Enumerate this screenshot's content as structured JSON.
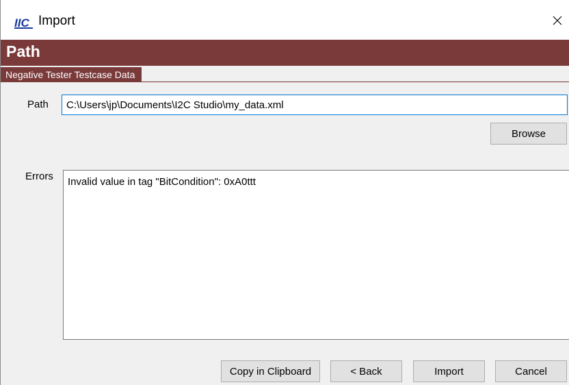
{
  "window": {
    "title": "Import",
    "app_icon": "iic-logo-icon",
    "close_icon": "close-icon"
  },
  "section": {
    "title": "Path",
    "subtitle": "Negative Tester Testcase Data"
  },
  "form": {
    "path_label": "Path",
    "path_value": "C:\\Users\\jp\\Documents\\I2C Studio\\my_data.xml",
    "browse_label": "Browse",
    "errors_label": "Errors",
    "errors_text": "Invalid value in tag \"BitCondition\": 0xA0ttt"
  },
  "buttons": {
    "copy_label": "Copy in Clipboard",
    "back_label": "< Back",
    "import_label": "Import",
    "cancel_label": "Cancel"
  },
  "colors": {
    "accent": "#7a3a3a",
    "logo_blue": "#1a3a9e",
    "focus_border": "#0078d7"
  }
}
